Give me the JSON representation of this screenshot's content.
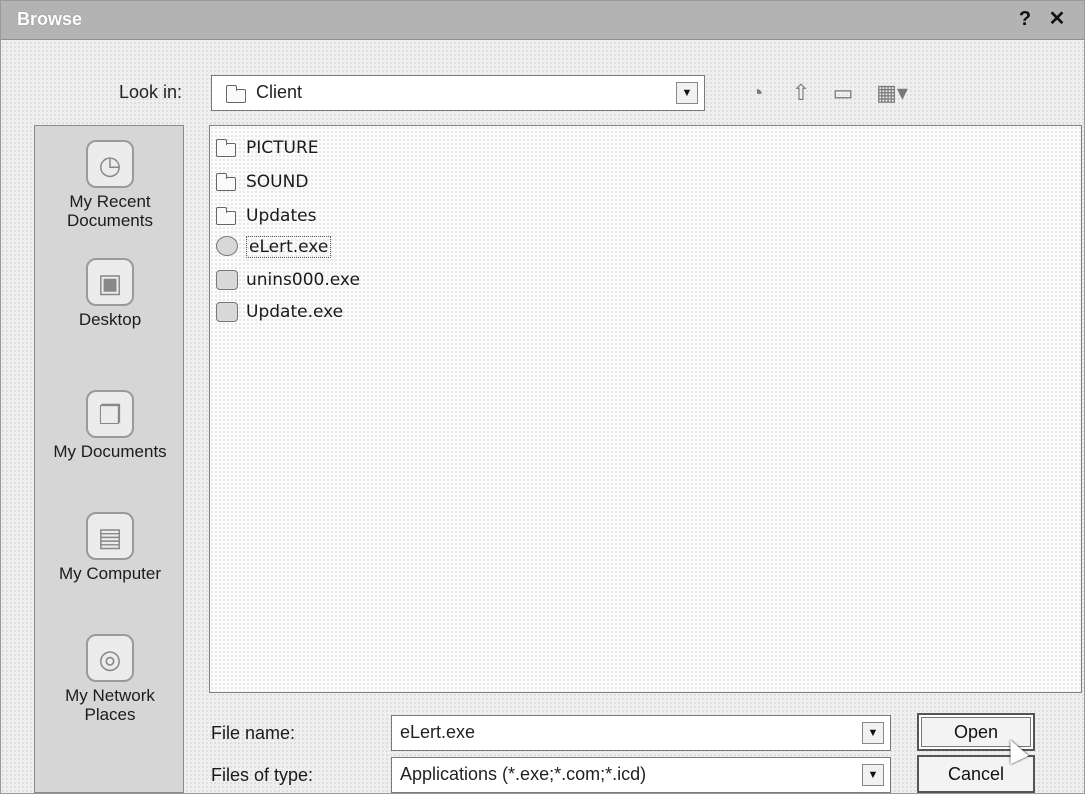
{
  "window": {
    "title": "Browse",
    "help_glyph": "?",
    "close_glyph": "✕"
  },
  "lookin": {
    "label": "Look in:",
    "value": "Client",
    "arrow": "▼"
  },
  "places": [
    {
      "label": "My Recent Documents",
      "icon": "recent-documents-icon"
    },
    {
      "label": "Desktop",
      "icon": "desktop-icon"
    },
    {
      "label": "My Documents",
      "icon": "my-documents-icon"
    },
    {
      "label": "My Computer",
      "icon": "my-computer-icon"
    },
    {
      "label": "My Network Places",
      "icon": "network-places-icon"
    }
  ],
  "files": [
    {
      "name": "PICTURE",
      "type": "folder"
    },
    {
      "name": "SOUND",
      "type": "folder"
    },
    {
      "name": "Updates",
      "type": "folder"
    },
    {
      "name": "eLert.exe",
      "type": "exe",
      "selected": true
    },
    {
      "name": "unins000.exe",
      "type": "exe"
    },
    {
      "name": "Update.exe",
      "type": "exe"
    }
  ],
  "filename": {
    "label": "File name:",
    "value": "eLert.exe",
    "arrow": "▼"
  },
  "filetype": {
    "label": "Files of type:",
    "value": "Applications (*.exe;*.com;*.icd)",
    "arrow": "▼"
  },
  "buttons": {
    "open": "Open",
    "cancel": "Cancel"
  }
}
